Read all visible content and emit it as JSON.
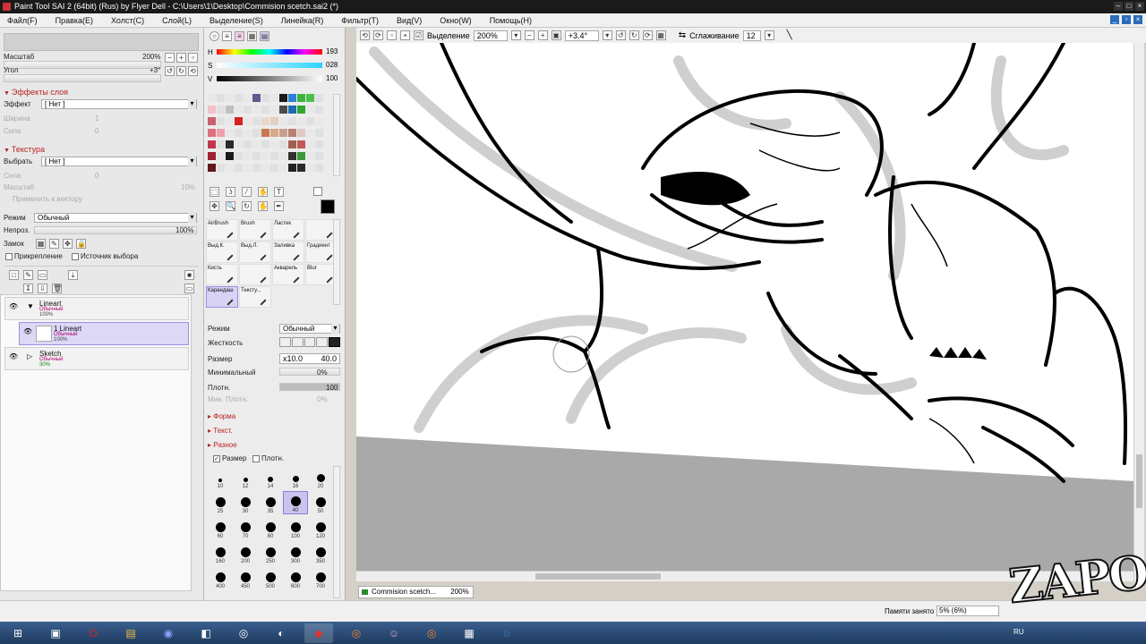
{
  "window": {
    "title": "Paint Tool SAI 2 (64bit) (Rus) by Flyer Dell - C:\\Users\\1\\Desktop\\Commision scetch.sai2 (*)"
  },
  "menu": [
    "Файл(F)",
    "Правка(E)",
    "Холст(C)",
    "Слой(L)",
    "Выделение(S)",
    "Линейка(R)",
    "Фильтр(T)",
    "Вид(V)",
    "Окно(W)",
    "Помощь(H)"
  ],
  "navigator": {
    "zoom_label": "Масштаб",
    "zoom_value": "200%",
    "angle_label": "Угол",
    "angle_value": "+3°"
  },
  "layer_effects": {
    "header": "Эффекты слоя",
    "effect_label": "Эффект",
    "effect_value": "[ Нет ]",
    "width_label": "Ширина",
    "width_value": "1",
    "strength_label": "Сила",
    "strength_value": "0"
  },
  "texture": {
    "header": "Текстура",
    "select_label": "Выбрать",
    "select_value": "[ Нет ]",
    "strength_label": "Сила",
    "strength_value": "0",
    "scale_label": "Масштаб",
    "scale_value": "10%",
    "apply_vector": "Применить к вектору"
  },
  "layer_props": {
    "mode_label": "Режим",
    "mode_value": "Обычный",
    "opacity_label": "Непроз.",
    "opacity_value": "100%",
    "opacity_level": 1.0,
    "lock_label": "Замок",
    "clip_label": "Прикрепление",
    "source_label": "Источник выбора"
  },
  "layers": [
    {
      "name": "Lineart",
      "mode": "Обычный",
      "opacity": "100%",
      "type": "folder"
    },
    {
      "name": "1 Lineart",
      "mode": "Обычный",
      "opacity": "100%",
      "type": "layer",
      "selected": true
    },
    {
      "name": "Sketch",
      "mode": "Обычный",
      "opacity": "30%",
      "type": "folder"
    }
  ],
  "color": {
    "h_label": "H",
    "h_value": "193",
    "s_label": "S",
    "s_value": "028",
    "v_label": "V",
    "v_value": "100"
  },
  "tools": [
    {
      "label": "AirBrush"
    },
    {
      "label": "Brush"
    },
    {
      "label": "Ластик"
    },
    {
      "label": ""
    },
    {
      "label": "Выд.К."
    },
    {
      "label": "Выд.Л."
    },
    {
      "label": "Заливка"
    },
    {
      "label": "Градиент"
    },
    {
      "label": "Кисть"
    },
    {
      "label": ""
    },
    {
      "label": "Акварель"
    },
    {
      "label": "Blur"
    },
    {
      "label": "Карандаш",
      "selected": true
    },
    {
      "label": "Тексту..."
    }
  ],
  "brush_settings": {
    "mode_label": "Режим",
    "mode_value": "Обычный",
    "hardness_label": "Жесткость",
    "size_label": "Размер",
    "size_mult": "x10.0",
    "size_value": "40.0",
    "min_label": "Минимальный",
    "min_value": "0%",
    "density_label": "Плотн.",
    "density_value": "100",
    "min_density_label": "Мин. Плотн.",
    "min_density_value": "0%",
    "shape": "Форма",
    "texture": "Текст.",
    "misc": "Разное",
    "size_chk": "Размер",
    "density_chk": "Плотн."
  },
  "brush_sizes": [
    "10",
    "12",
    "14",
    "16",
    "20",
    "25",
    "30",
    "35",
    "40",
    "50",
    "60",
    "70",
    "80",
    "100",
    "120",
    "160",
    "200",
    "250",
    "300",
    "350",
    "400",
    "450",
    "500",
    "600",
    "700"
  ],
  "canvas_toolbar": {
    "selection_label": "Выделение",
    "zoom_value": "200%",
    "angle_value": "+3.4°",
    "smooth_label": "Сглаживание",
    "smooth_value": "12"
  },
  "document_tab": {
    "name": "Commision scetch...",
    "zoom": "200%"
  },
  "status": {
    "memory_label": "Памяти занято",
    "memory_value": "5% (6%)"
  },
  "watermark": "ZAPOR",
  "taskbar": {
    "lang": "RU"
  }
}
